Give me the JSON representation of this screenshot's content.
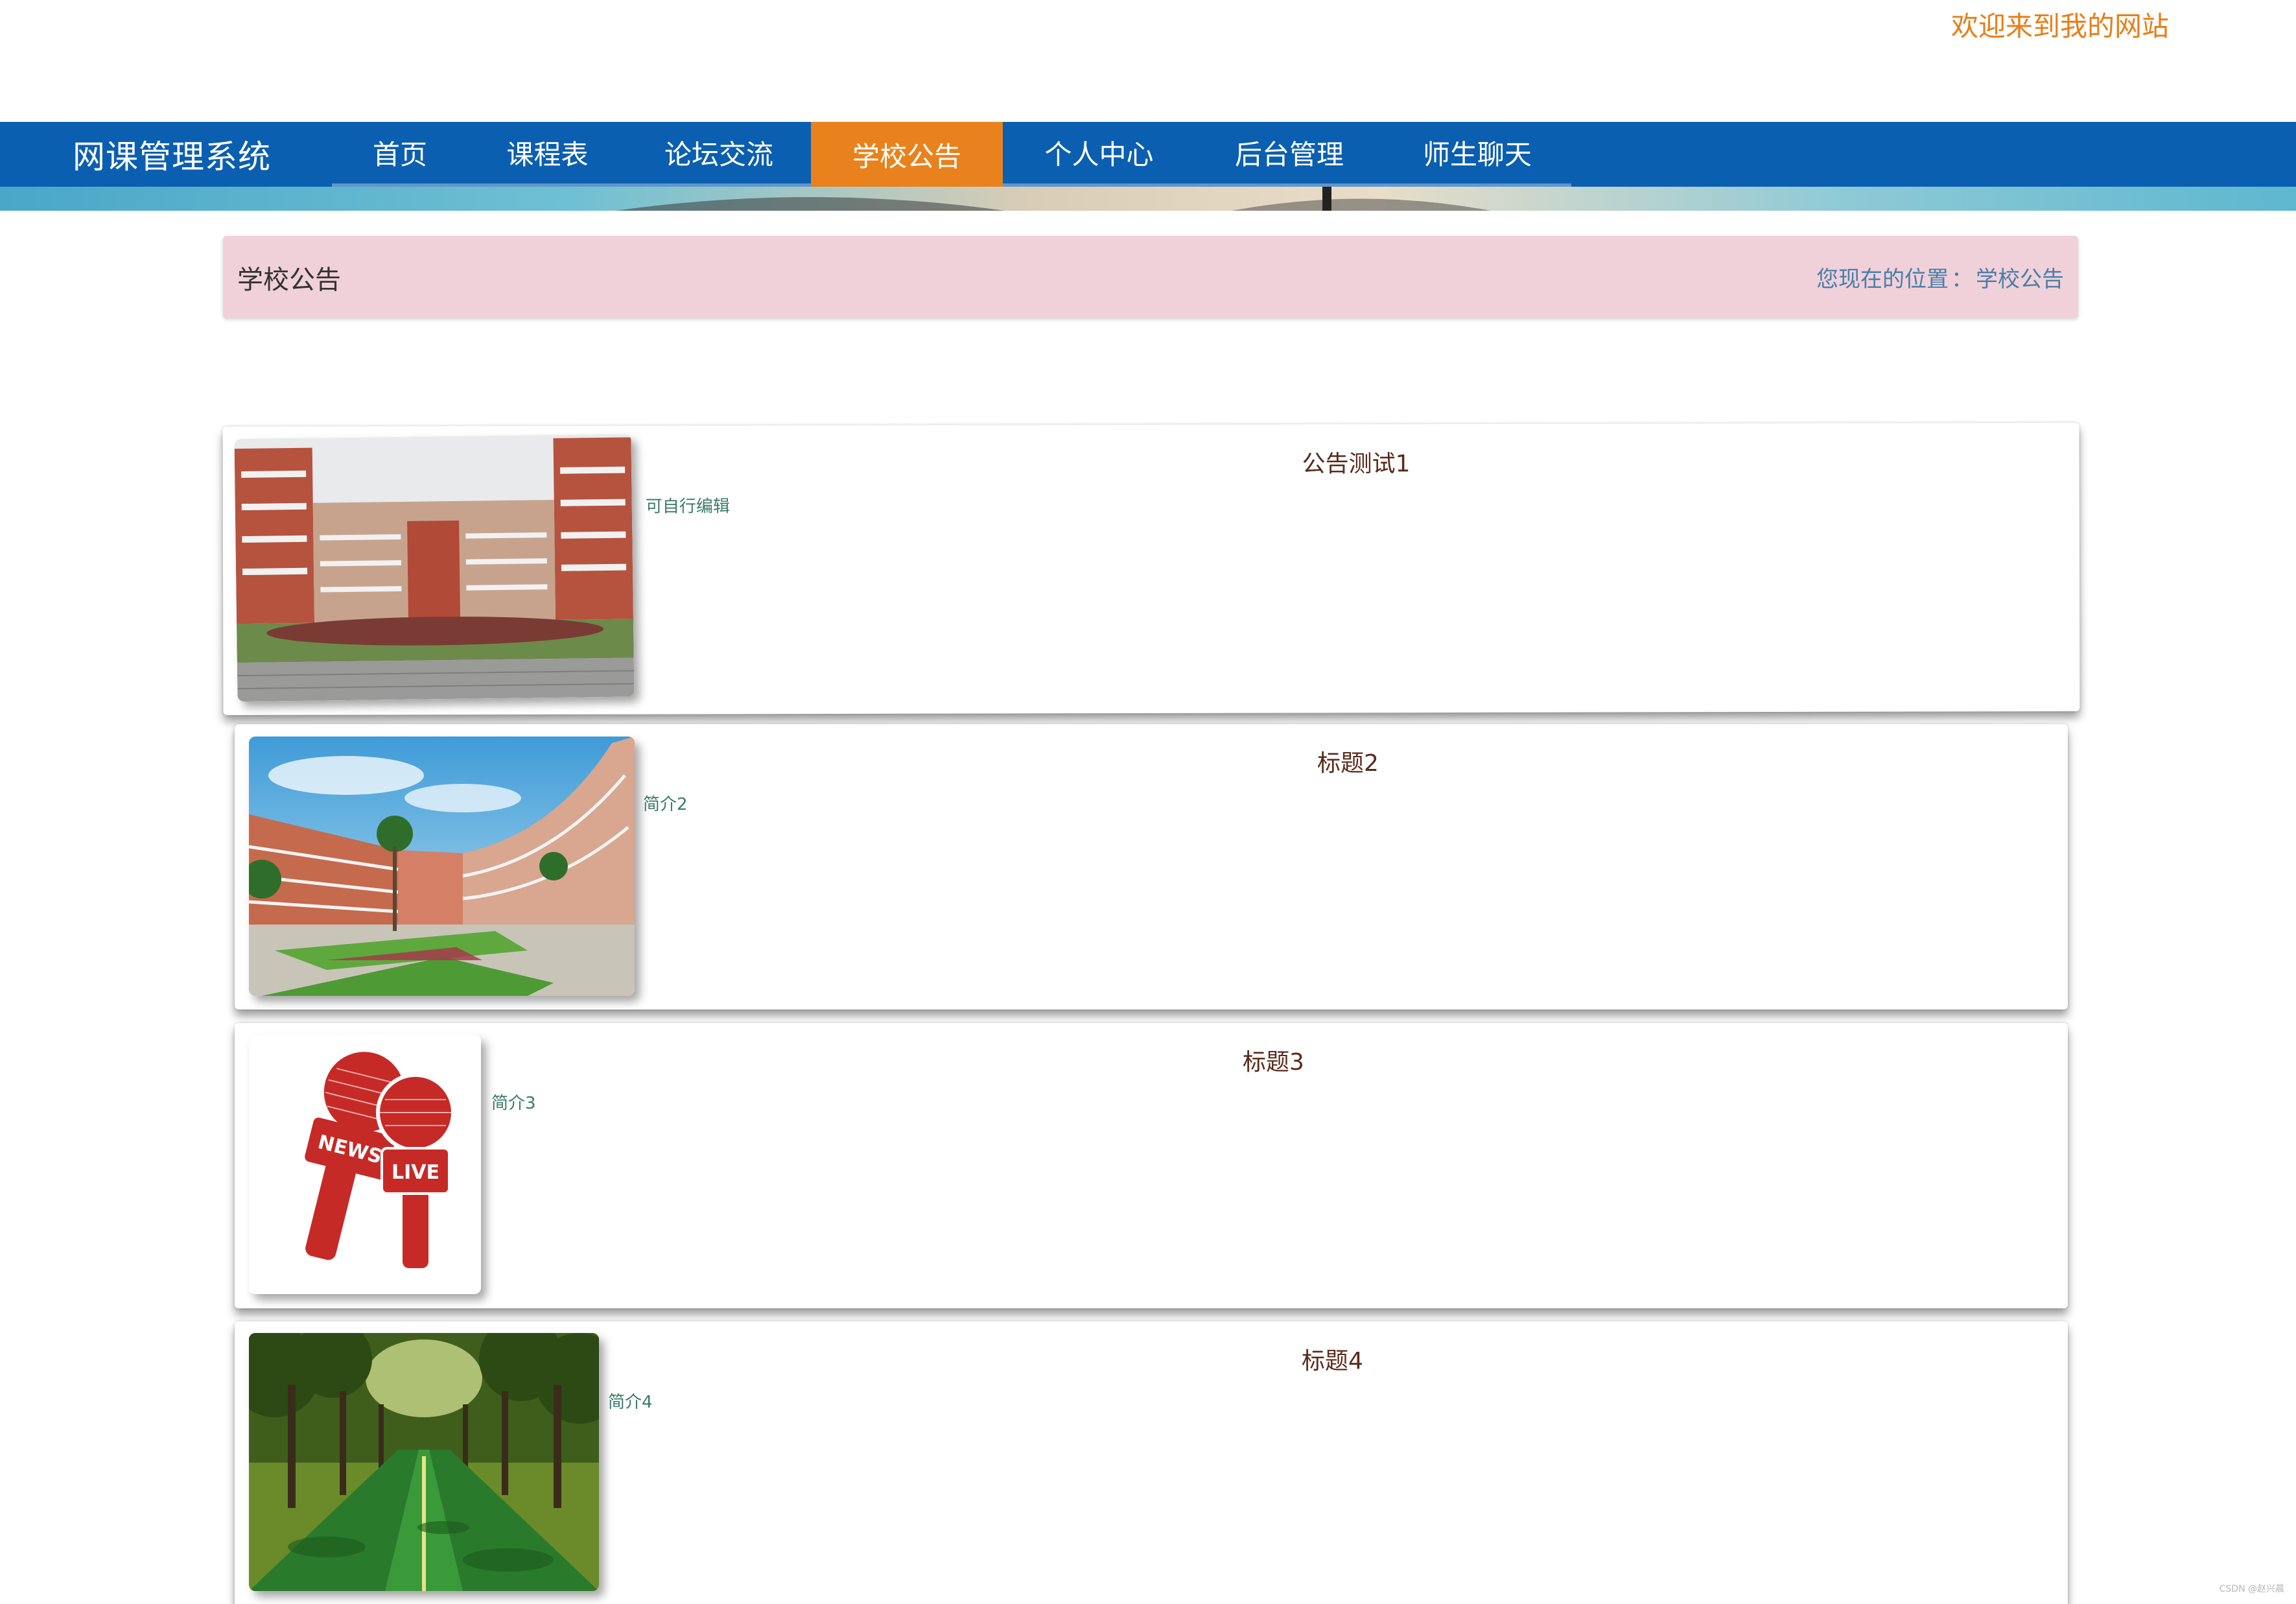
{
  "header": {
    "welcome": "欢迎来到我的网站"
  },
  "nav": {
    "brand": "网课管理系统",
    "items": [
      {
        "label": "首页",
        "active": false
      },
      {
        "label": "课程表",
        "active": false
      },
      {
        "label": "论坛交流",
        "active": false
      },
      {
        "label": "学校公告",
        "active": true
      },
      {
        "label": "个人中心",
        "active": false
      },
      {
        "label": "后台管理",
        "active": false
      },
      {
        "label": "师生聊天",
        "active": false
      }
    ],
    "colors": {
      "bar": "#0b5fb0",
      "active": "#e9821c"
    }
  },
  "page": {
    "title": "学校公告",
    "breadcrumb_prefix": "您现在的位置",
    "breadcrumb_current": "学校公告"
  },
  "notices": [
    {
      "title": "公告测试1",
      "summary": "可自行编辑",
      "image": "school-building-photo"
    },
    {
      "title": "标题2",
      "summary": "简介2",
      "image": "campus-courtyard-photo"
    },
    {
      "title": "标题3",
      "summary": "简介3",
      "image": "news-live-microphone-icon"
    },
    {
      "title": "标题4",
      "summary": "简介4",
      "image": "tree-lined-road-photo"
    }
  ],
  "footer": {
    "watermark": "CSDN @赵兴晨"
  }
}
